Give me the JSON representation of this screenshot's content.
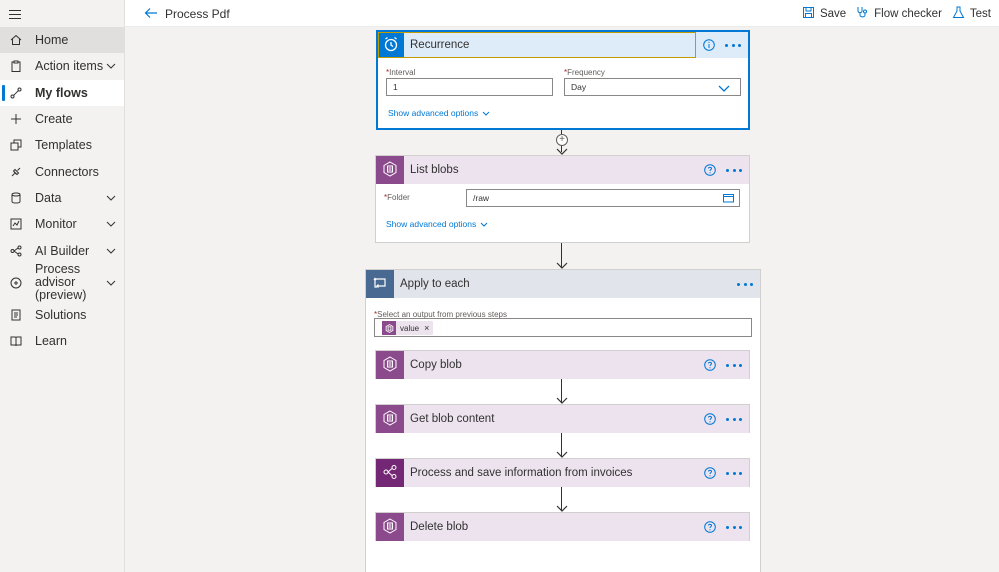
{
  "header": {
    "title": "Process Pdf",
    "save_label": "Save",
    "flow_checker_label": "Flow checker",
    "test_label": "Test"
  },
  "sidebar": {
    "items": [
      {
        "label": "Home",
        "icon": "home-icon"
      },
      {
        "label": "Action items",
        "icon": "clipboard-icon"
      },
      {
        "label": "My flows",
        "icon": "flow-icon"
      },
      {
        "label": "Create",
        "icon": "plus-icon"
      },
      {
        "label": "Templates",
        "icon": "templates-icon"
      },
      {
        "label": "Connectors",
        "icon": "connectors-icon"
      },
      {
        "label": "Data",
        "icon": "database-icon"
      },
      {
        "label": "Monitor",
        "icon": "monitor-icon"
      },
      {
        "label": "AI Builder",
        "icon": "ai-builder-icon"
      },
      {
        "label": "Process advisor",
        "label2": "(preview)",
        "icon": "process-advisor-icon"
      },
      {
        "label": "Solutions",
        "icon": "solutions-icon"
      },
      {
        "label": "Learn",
        "icon": "book-icon"
      }
    ]
  },
  "flow": {
    "recurrence": {
      "title": "Recurrence",
      "interval_label": "Interval",
      "interval_value": "1",
      "frequency_label": "Frequency",
      "frequency_value": "Day",
      "advanced": "Show advanced options"
    },
    "list_blobs": {
      "title": "List blobs",
      "folder_label": "Folder",
      "folder_value": "/raw",
      "advanced": "Show advanced options"
    },
    "apply_to_each": {
      "title": "Apply to each",
      "select_label": "Select an output from previous steps",
      "token_label": "value",
      "token_remove": "×"
    },
    "steps": [
      {
        "title": "Copy blob"
      },
      {
        "title": "Get blob content"
      },
      {
        "title": "Process and save information from invoices"
      },
      {
        "title": "Delete blob"
      }
    ],
    "required_mark": "*",
    "plus_sign": "+"
  },
  "colors": {
    "accent": "#0078d4",
    "recurrence_head": "#deecf9",
    "blob_purple": "#8b4a8c",
    "ai_purple": "#742774",
    "loop_blue": "#486991"
  }
}
